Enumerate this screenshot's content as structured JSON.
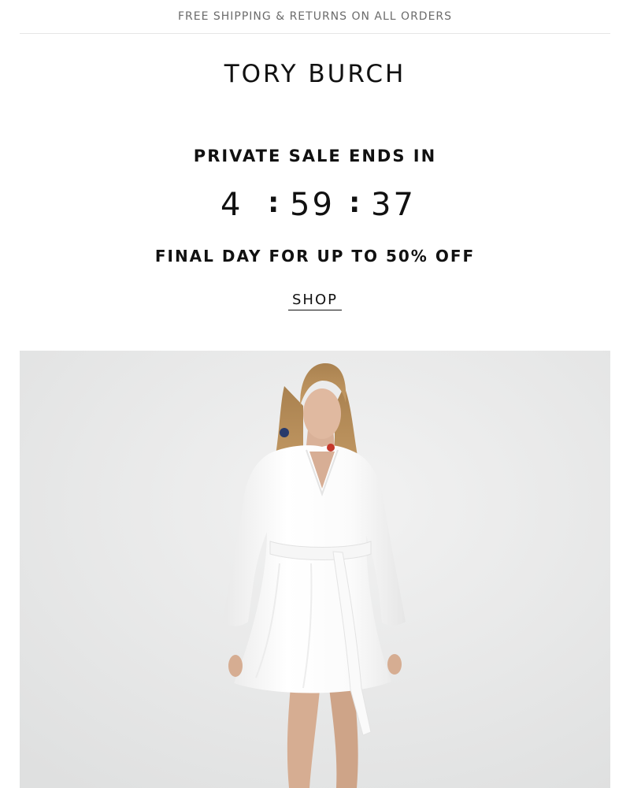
{
  "banner": {
    "shipping_text": "FREE SHIPPING & RETURNS ON ALL ORDERS"
  },
  "brand": {
    "logo_text": "TORY BURCH"
  },
  "promo": {
    "heading": "PRIVATE SALE ENDS IN",
    "countdown": {
      "hours": "4",
      "minutes": "59",
      "seconds": "37",
      "separator": ":"
    },
    "subheading": "FINAL DAY FOR UP TO 50% OFF",
    "cta_label": "SHOP"
  },
  "colors": {
    "text": "#111111",
    "muted": "#6b6b6b",
    "divider": "#e6e6e6",
    "hero_background": "#e9e9e9",
    "dress": "#ffffff"
  }
}
